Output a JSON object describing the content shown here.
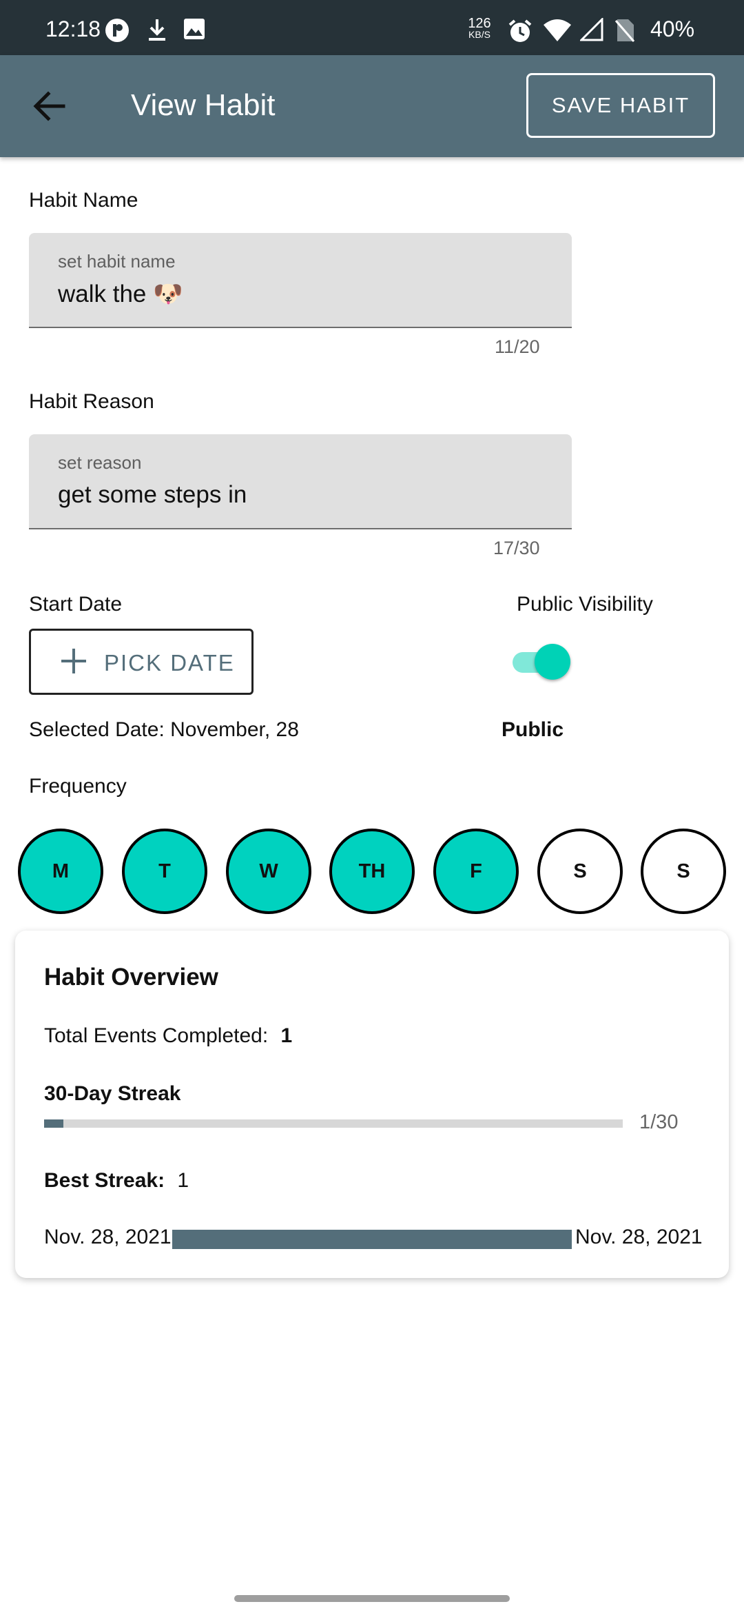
{
  "status_bar": {
    "time": "12:18",
    "net_speed_value": "126",
    "net_speed_unit": "KB/S",
    "battery": "40%"
  },
  "app_bar": {
    "title": "View Habit",
    "save_label": "SAVE HABIT"
  },
  "habit_name": {
    "label": "Habit Name",
    "placeholder": "set habit name",
    "value": "walk the 🐶",
    "counter": "11/20"
  },
  "habit_reason": {
    "label": "Habit Reason",
    "placeholder": "set reason",
    "value": "get some steps in",
    "counter": "17/30"
  },
  "start_date": {
    "label": "Start Date",
    "button_label": "PICK DATE",
    "selected_text": "Selected Date: November, 28"
  },
  "visibility": {
    "label": "Public Visibility",
    "state_text": "Public",
    "enabled": true
  },
  "frequency": {
    "label": "Frequency",
    "days": [
      {
        "label": "M",
        "selected": true
      },
      {
        "label": "T",
        "selected": true
      },
      {
        "label": "W",
        "selected": true
      },
      {
        "label": "TH",
        "selected": true
      },
      {
        "label": "F",
        "selected": true
      },
      {
        "label": "S",
        "selected": false
      },
      {
        "label": "S",
        "selected": false
      }
    ]
  },
  "overview": {
    "title": "Habit Overview",
    "total_label": "Total Events Completed:",
    "total_value": "1",
    "streak_label": "30-Day Streak",
    "streak_progress_text": "1/30",
    "streak_progress_fraction": 0.0333,
    "best_label": "Best Streak:",
    "best_value": "1",
    "best_start": "Nov. 28, 2021",
    "best_end": "Nov. 28, 2021"
  },
  "colors": {
    "primary": "#546e7a",
    "accent": "#00d2bf",
    "status_bar": "#263238"
  },
  "icons": {
    "back": "arrow-left-icon",
    "add": "plus-icon"
  }
}
